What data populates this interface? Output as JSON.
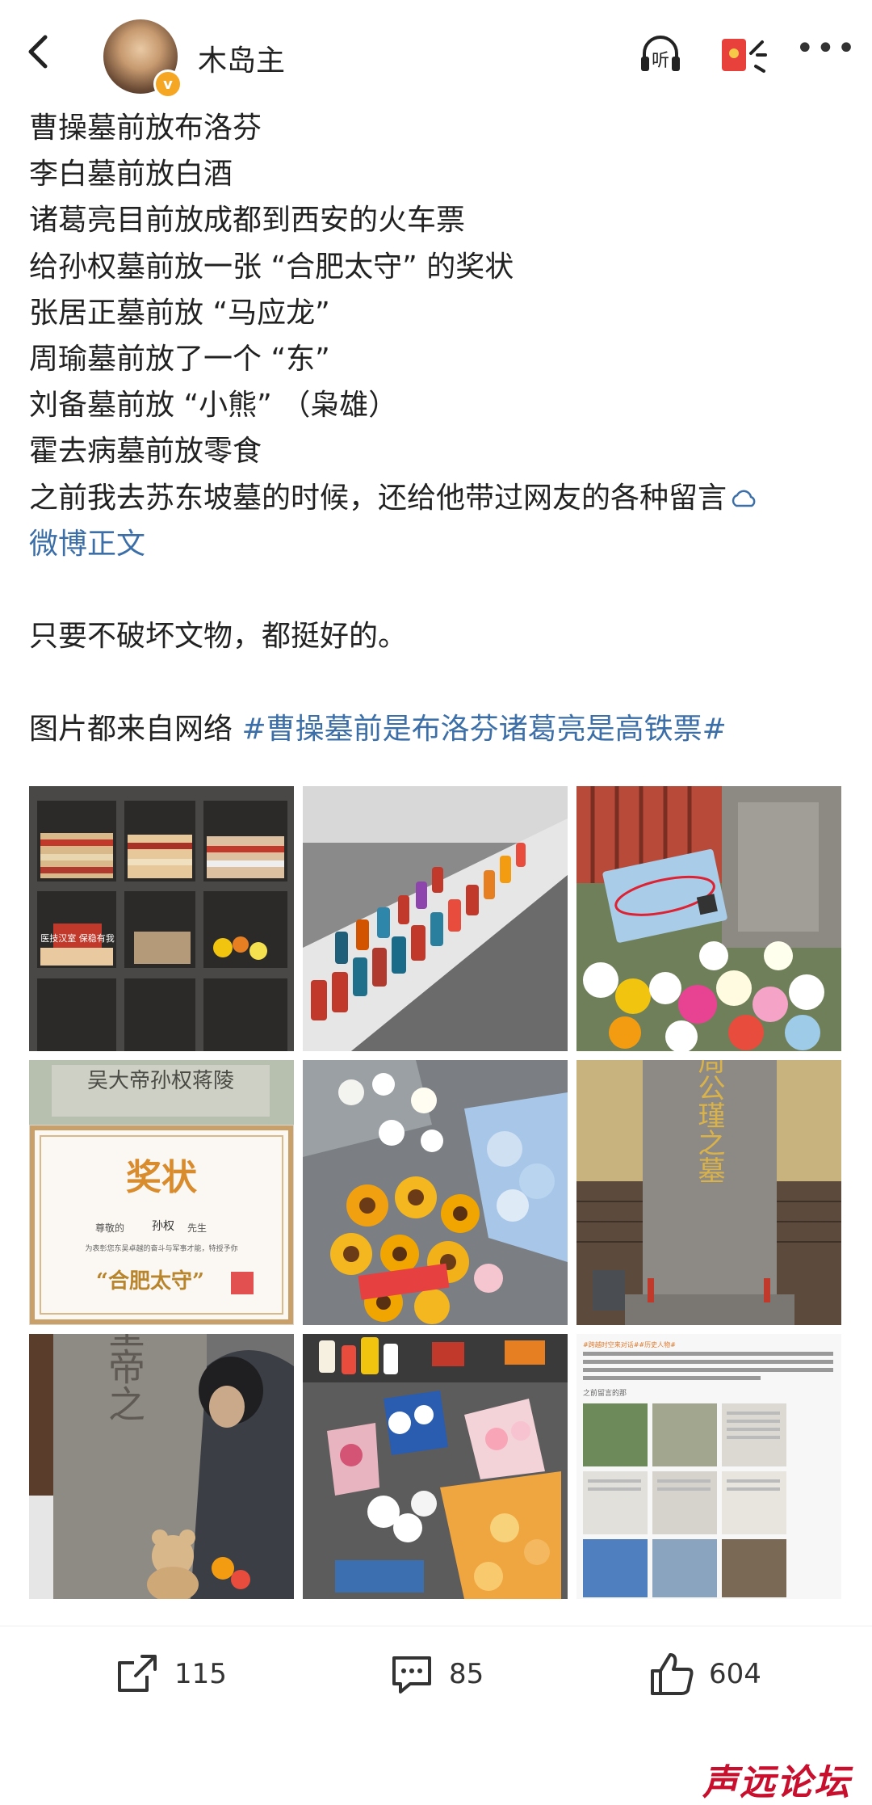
{
  "header": {
    "username": "木岛主",
    "verified_badge": "v",
    "icons": [
      "back-icon",
      "headphones-icon",
      "red-packet-icon",
      "more-icon"
    ],
    "listen_label": "听"
  },
  "post": {
    "lines": [
      "曹操墓前放布洛芬",
      "李白墓前放白酒",
      "诸葛亮目前放成都到西安的火车票",
      "给孙权墓前放一张 “合肥太守” 的奖状",
      "张居正墓前放 “马应龙”",
      "周瑜墓前放了一个 “东”",
      "刘备墓前放 “小熊” （枭雄）",
      "霍去病墓前放零食",
      "之前我去苏东坡墓的时候，还给他带过网友的各种留言"
    ],
    "weibo_link": "微博正文",
    "closing": "只要不破坏文物，都挺好的。",
    "source_prefix": "图片都来自网络 ",
    "hashtag": "#曹操墓前是布洛芬诸葛亮是高铁票#"
  },
  "images": {
    "captions": {
      "sign_red": "医技汉室 保稳有我",
      "tomb_sunquan": "吴大帝孙权蒋陵",
      "certificate_title": "奖状",
      "certificate_to": "尊敬的",
      "certificate_name": "孙权",
      "certificate_honorific": "先生",
      "certificate_body": "为表彰您东吴卓越的奋斗与军事才能，特授予你",
      "certificate_award": "“合肥太守”",
      "zhouyu_stele": "名将周公瑾之墓",
      "emperor_stele": "皇帝之",
      "sudongpo_header": "#跨越时空来对话##历史人物#",
      "sudongpo_sub": "之前留言的那"
    }
  },
  "actions": {
    "share_count": "115",
    "comment_count": "85",
    "like_count": "604"
  },
  "watermark": "声远论坛",
  "colors": {
    "link_blue": "#3c6fa8",
    "badge_orange": "#f5a623",
    "watermark_red": "#c8102e"
  }
}
